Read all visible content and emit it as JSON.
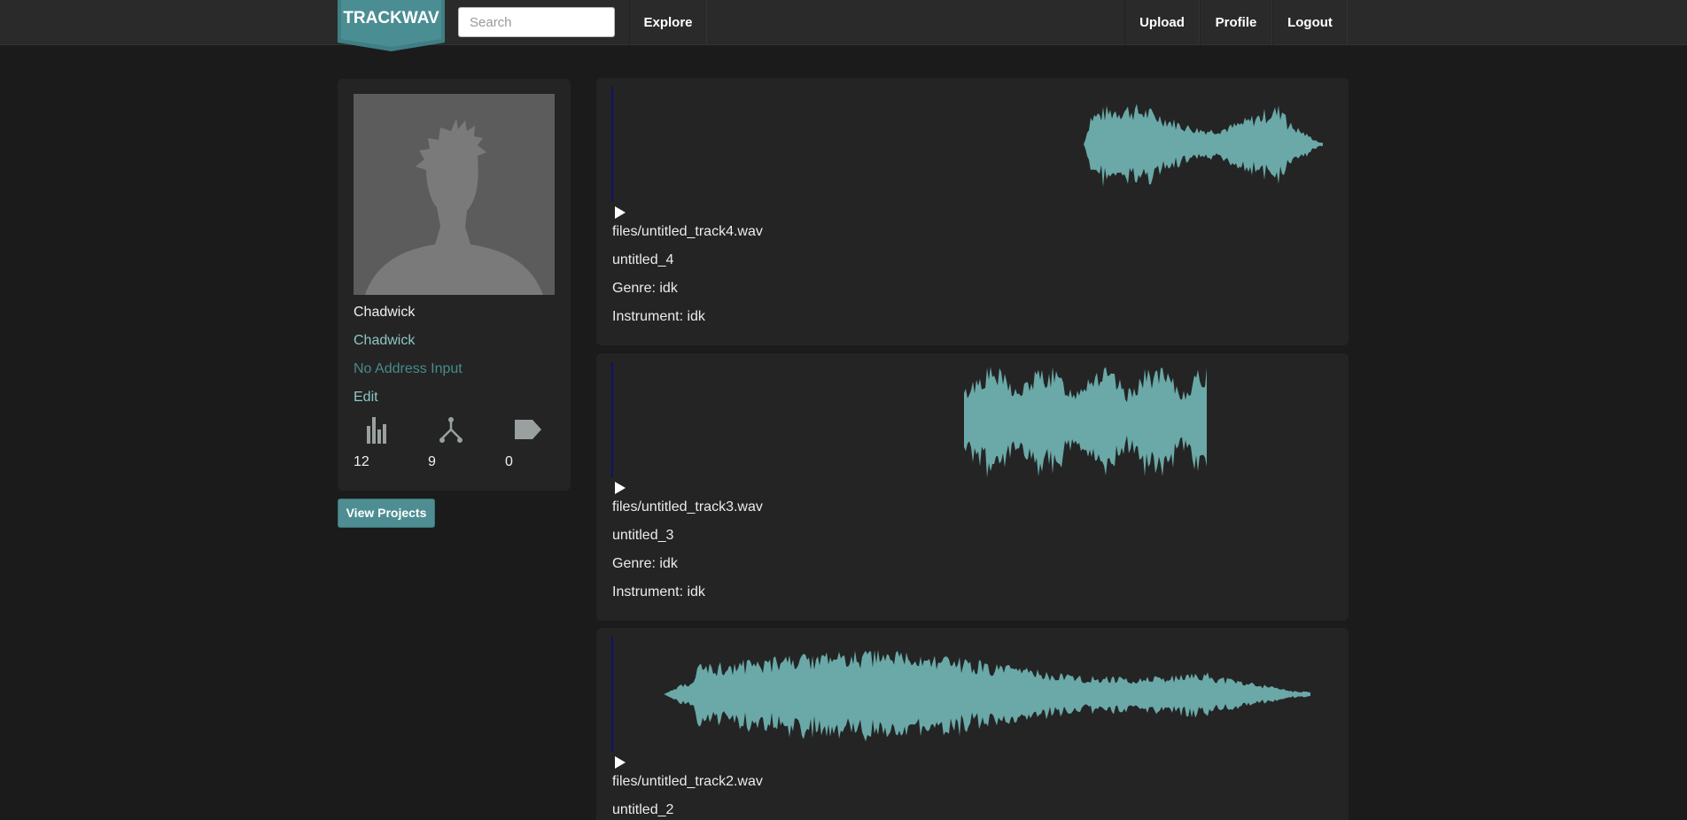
{
  "nav": {
    "logo_text": "TRACKWAV",
    "search_placeholder": "Search",
    "explore": "Explore",
    "upload": "Upload",
    "profile": "Profile",
    "logout": "Logout"
  },
  "profile": {
    "name": "Chadwick",
    "username": "Chadwick",
    "address": "No Address Input",
    "edit_label": "Edit",
    "stats": [
      {
        "icon": "bar-chart-icon",
        "value": "12"
      },
      {
        "icon": "fork-icon",
        "value": "9"
      },
      {
        "icon": "tag-icon",
        "value": "0"
      }
    ],
    "view_projects_label": "View Projects"
  },
  "tracks": [
    {
      "file": "files/untitled_track4.wav",
      "title": "untitled_4",
      "genre": "Genre: idk",
      "instrument": "Instrument: idk"
    },
    {
      "file": "files/untitled_track3.wav",
      "title": "untitled_3",
      "genre": "Genre: idk",
      "instrument": "Instrument: idk"
    },
    {
      "file": "files/untitled_track2.wav",
      "title": "untitled_2"
    }
  ],
  "colors": {
    "waveform": "#6aa9a8",
    "accent": "#4e8e92",
    "link": "#8fc6c6"
  }
}
